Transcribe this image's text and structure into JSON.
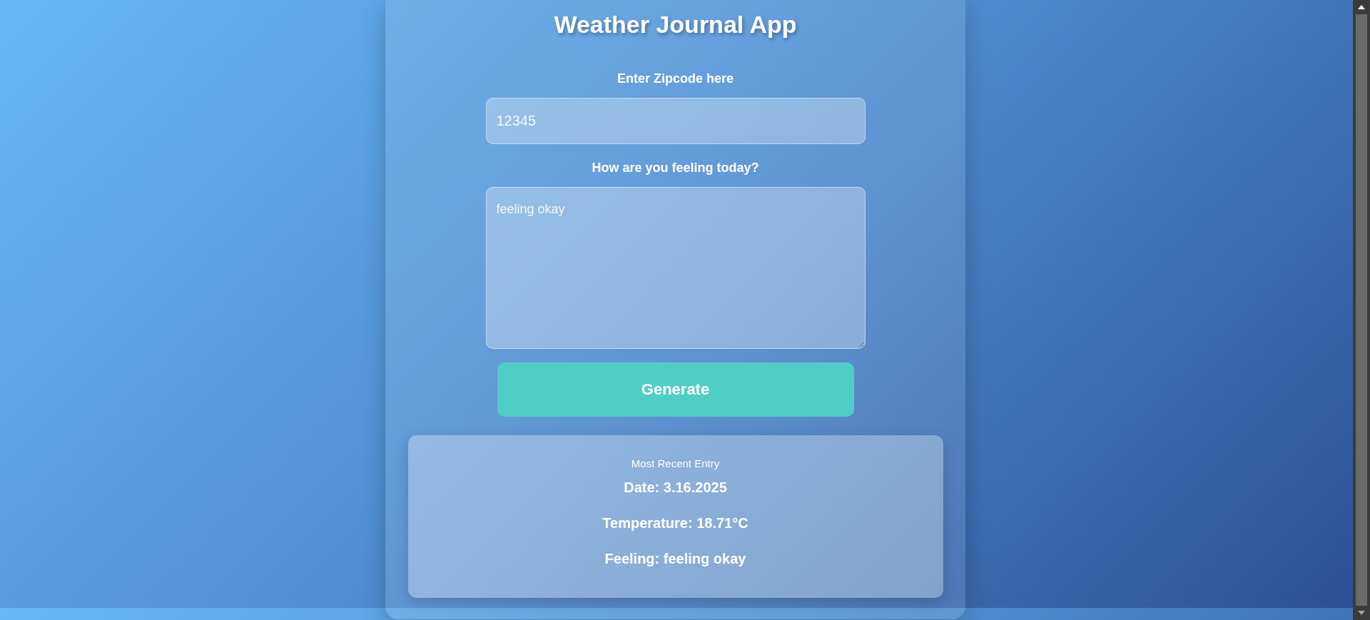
{
  "title": "Weather Journal App",
  "zip": {
    "label": "Enter Zipcode here",
    "value": "12345"
  },
  "feelings": {
    "label": "How are you feeling today?",
    "value": "feeling okay"
  },
  "generate_button": "Generate",
  "entry": {
    "heading": "Most Recent Entry",
    "date": "Date: 3.16.2025",
    "temperature": "Temperature: 18.71°C",
    "feeling": "Feeling: feeling okay"
  }
}
